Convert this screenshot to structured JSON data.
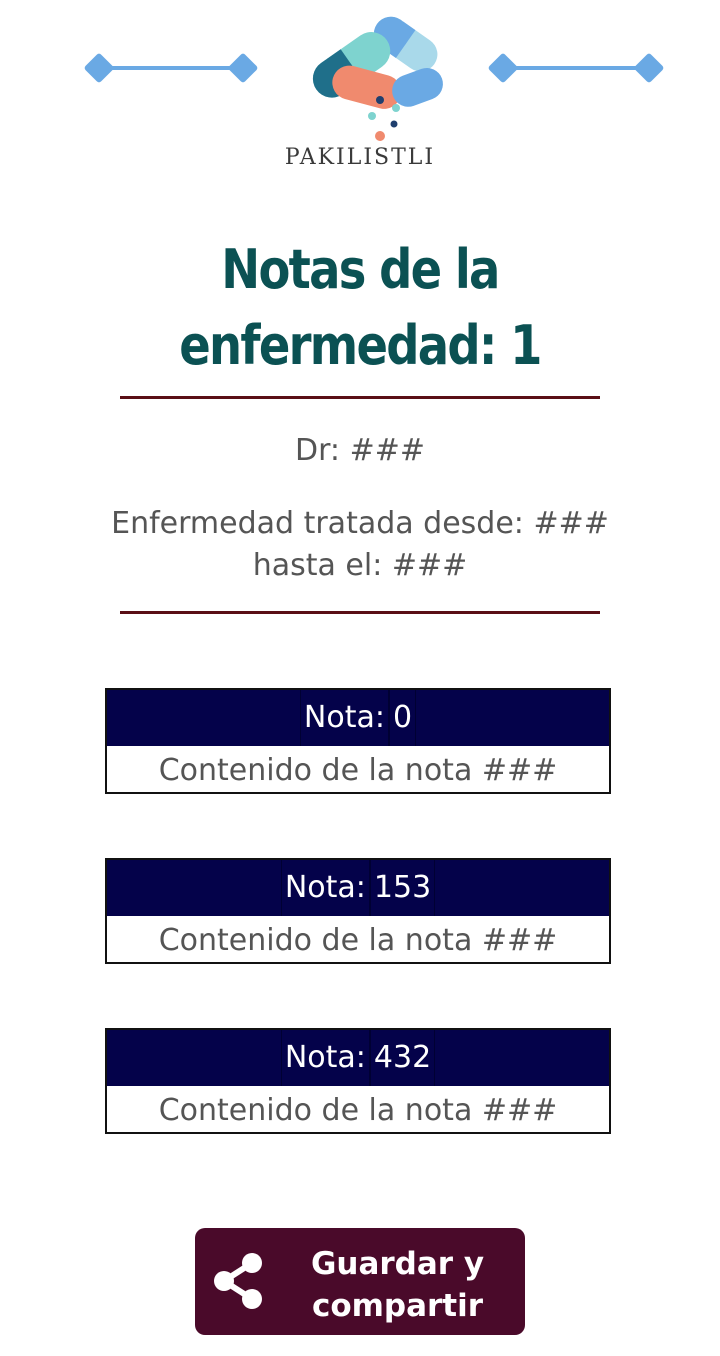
{
  "logo": {
    "text": "PAKILISTLI"
  },
  "title": "Notas de la enfermedad: 1",
  "doctor": "Dr: ###",
  "treatment": {
    "line1": "Enfermedad tratada desde: ###",
    "line2": "hasta el: ###"
  },
  "notes": [
    {
      "label": "Nota:",
      "number": "0",
      "content": "Contenido de la nota ###"
    },
    {
      "label": "Nota:",
      "number": "153",
      "content": "Contenido de la nota ###"
    },
    {
      "label": "Nota:",
      "number": "432",
      "content": "Contenido de la nota ###"
    }
  ],
  "share_button": {
    "line1": "Guardar y",
    "line2": "compartir",
    "icon": "share-icon"
  },
  "colors": {
    "title": "#0b5153",
    "divider": "#5a0f15",
    "note_header": "#04024a",
    "button": "#4a0a2a",
    "decoration": "#6aa9e4"
  }
}
